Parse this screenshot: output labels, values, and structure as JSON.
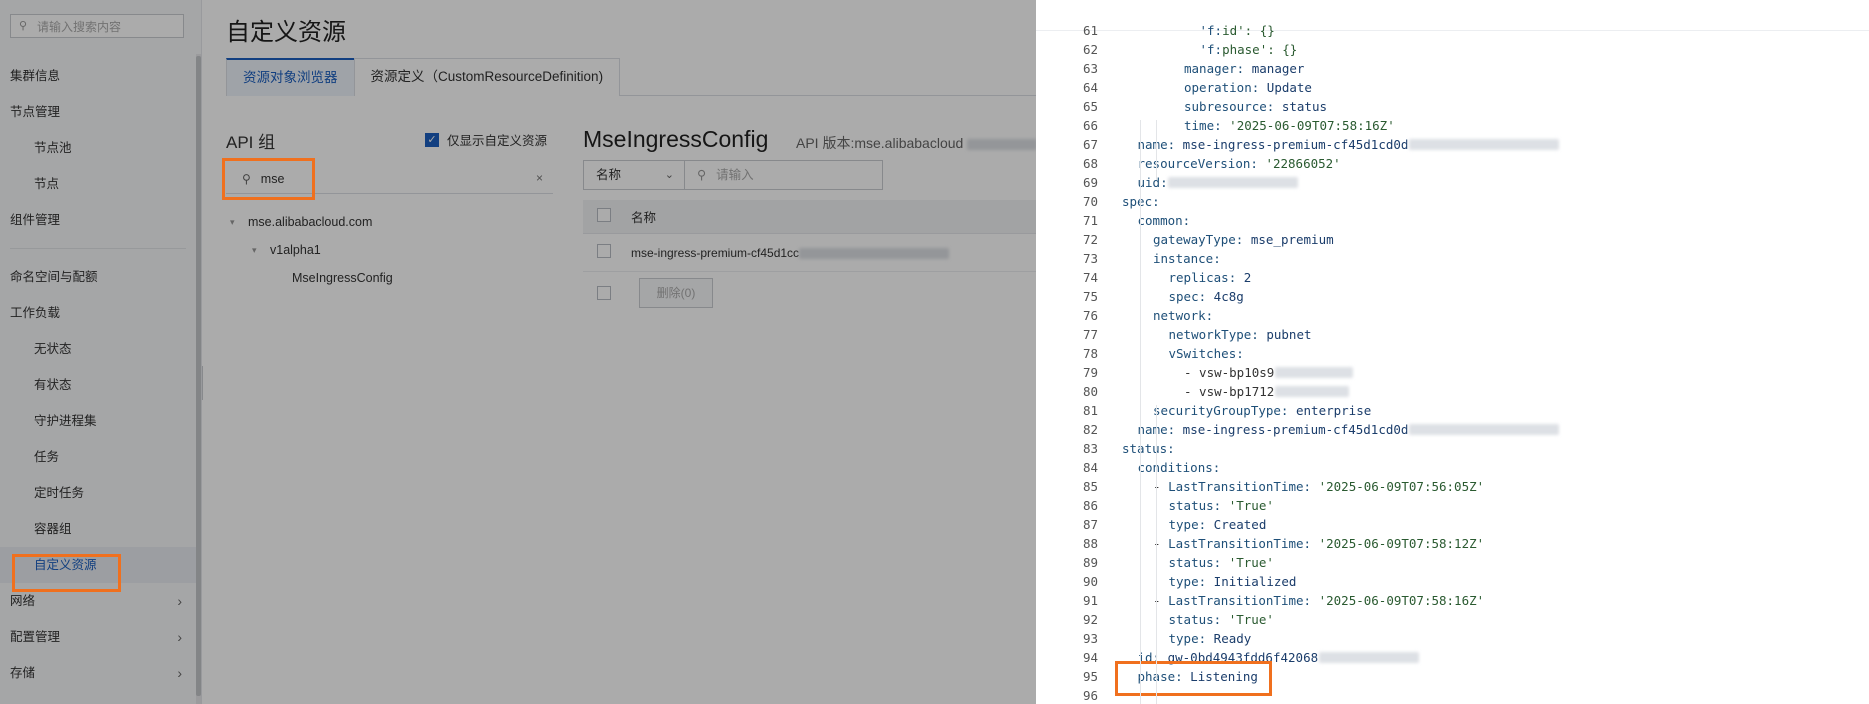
{
  "sidebar": {
    "search_placeholder": "请输入搜索内容",
    "items": [
      {
        "label": "集群信息"
      },
      {
        "label": "节点管理"
      },
      {
        "label": "节点池"
      },
      {
        "label": "节点"
      },
      {
        "label": "组件管理"
      },
      {
        "label": "命名空间与配额"
      },
      {
        "label": "工作负载"
      },
      {
        "label": "无状态"
      },
      {
        "label": "有状态"
      },
      {
        "label": "守护进程集"
      },
      {
        "label": "任务"
      },
      {
        "label": "定时任务"
      },
      {
        "label": "容器组"
      },
      {
        "label": "自定义资源"
      },
      {
        "label": "网络"
      },
      {
        "label": "配置管理"
      },
      {
        "label": "存储"
      }
    ]
  },
  "main": {
    "title": "自定义资源",
    "tabs": [
      {
        "label": "资源对象浏览器"
      },
      {
        "label": "资源定义（CustomResourceDefinition)"
      }
    ],
    "api_group_title": "API 组",
    "only_custom_label": "仅显示自定义资源",
    "api_search_value": "mse",
    "tree": {
      "group": "mse.alibabacloud.com",
      "version": "v1alpha1",
      "kind": "MseIngressConfig"
    },
    "resource_title": "MseIngressConfig",
    "api_version_label": "API 版本:mse.alibabacloud",
    "filter_select": "名称",
    "filter_placeholder": "请输入",
    "table_header": "名称",
    "table_rows": [
      {
        "name": "mse-ingress-premium-cf45d1cc"
      }
    ],
    "delete_button": "删除(0)"
  },
  "yaml": {
    "lines": [
      {
        "n": "61",
        "text": "'f:id': {}"
      },
      {
        "n": "62",
        "text": "'f:phase': {}"
      },
      {
        "n": "63",
        "text": "manager: manager"
      },
      {
        "n": "64",
        "text": "operation: Update"
      },
      {
        "n": "65",
        "text": "subresource: status"
      },
      {
        "n": "66",
        "text": "time: '2025-06-09T07:58:16Z'"
      },
      {
        "n": "67",
        "text": "name: mse-ingress-premium-cf45d1cd0d"
      },
      {
        "n": "68",
        "text": "resourceVersion: '22866052'"
      },
      {
        "n": "69",
        "text": "uid:"
      },
      {
        "n": "70",
        "text": "spec:"
      },
      {
        "n": "71",
        "text": "common:"
      },
      {
        "n": "72",
        "text": "gatewayType: mse_premium"
      },
      {
        "n": "73",
        "text": "instance:"
      },
      {
        "n": "74",
        "text": "replicas: 2"
      },
      {
        "n": "75",
        "text": "spec: 4c8g"
      },
      {
        "n": "76",
        "text": "network:"
      },
      {
        "n": "77",
        "text": "networkType: pubnet"
      },
      {
        "n": "78",
        "text": "vSwitches:"
      },
      {
        "n": "79",
        "text": "- vsw-bp10s9"
      },
      {
        "n": "80",
        "text": "- vsw-bp1712"
      },
      {
        "n": "81",
        "text": "securityGroupType: enterprise"
      },
      {
        "n": "82",
        "text": "name: mse-ingress-premium-cf45d1cd0d"
      },
      {
        "n": "83",
        "text": "status:"
      },
      {
        "n": "84",
        "text": "conditions:"
      },
      {
        "n": "85",
        "text": "- LastTransitionTime: '2025-06-09T07:56:05Z'"
      },
      {
        "n": "86",
        "text": "status: 'True'"
      },
      {
        "n": "87",
        "text": "type: Created"
      },
      {
        "n": "88",
        "text": "- LastTransitionTime: '2025-06-09T07:58:12Z'"
      },
      {
        "n": "89",
        "text": "status: 'True'"
      },
      {
        "n": "90",
        "text": "type: Initialized"
      },
      {
        "n": "91",
        "text": "- LastTransitionTime: '2025-06-09T07:58:16Z'"
      },
      {
        "n": "92",
        "text": "status: 'True'"
      },
      {
        "n": "93",
        "text": "type: Ready"
      },
      {
        "n": "94",
        "text": "id: gw-0bd4943fdd6f42068"
      },
      {
        "n": "95",
        "text": "phase: Listening"
      },
      {
        "n": "96",
        "text": ""
      }
    ]
  },
  "colors": {
    "accent": "#1b5fbf",
    "highlight": "#f0701e"
  }
}
